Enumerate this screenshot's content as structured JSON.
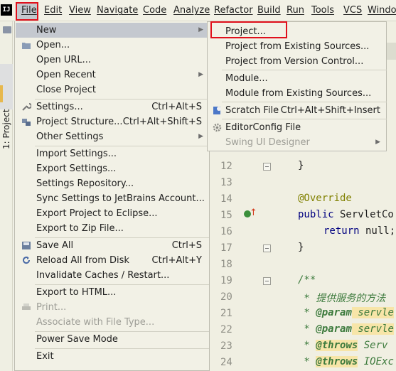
{
  "menubar": {
    "logo": "IJ",
    "items": [
      "File",
      "Edit",
      "View",
      "Navigate",
      "Code",
      "Analyze",
      "Refactor",
      "Build",
      "Run",
      "Tools",
      "VCS",
      "Window"
    ]
  },
  "sidebar": {
    "project_tab": "1: Project"
  },
  "file_menu": {
    "items": [
      {
        "label": "New",
        "arrow": "▶"
      },
      {
        "label": "Open..."
      },
      {
        "label": "Open URL..."
      },
      {
        "label": "Open Recent",
        "arrow": "▶"
      },
      {
        "label": "Close Project"
      },
      {
        "label": "Settings...",
        "shortcut": "Ctrl+Alt+S"
      },
      {
        "label": "Project Structure...",
        "shortcut": "Ctrl+Alt+Shift+S"
      },
      {
        "label": "Other Settings",
        "arrow": "▶"
      },
      {
        "label": "Import Settings..."
      },
      {
        "label": "Export Settings..."
      },
      {
        "label": "Settings Repository..."
      },
      {
        "label": "Sync Settings to JetBrains Account..."
      },
      {
        "label": "Export Project to Eclipse..."
      },
      {
        "label": "Export to Zip File..."
      },
      {
        "label": "Save All",
        "shortcut": "Ctrl+S"
      },
      {
        "label": "Reload All from Disk",
        "shortcut": "Ctrl+Alt+Y"
      },
      {
        "label": "Invalidate Caches / Restart..."
      },
      {
        "label": "Export to HTML..."
      },
      {
        "label": "Print..."
      },
      {
        "label": "Associate with File Type..."
      },
      {
        "label": "Power Save Mode"
      },
      {
        "label": "Exit"
      }
    ]
  },
  "new_submenu": {
    "items": [
      {
        "label": "Project..."
      },
      {
        "label": "Project from Existing Sources..."
      },
      {
        "label": "Project from Version Control..."
      },
      {
        "label": "Module..."
      },
      {
        "label": "Module from Existing Sources..."
      },
      {
        "label": "Scratch File",
        "shortcut": "Ctrl+Alt+Shift+Insert"
      },
      {
        "label": "EditorConfig File"
      },
      {
        "label": "Swing UI Designer",
        "arrow": "▶"
      }
    ]
  },
  "editor": {
    "line_numbers": [
      "12",
      "13",
      "14",
      "15",
      "16",
      "17",
      "18",
      "19",
      "20",
      "21",
      "22",
      "23",
      "24"
    ],
    "code": {
      "l12": "}",
      "l14": "@Override",
      "l15_kw": "public",
      "l15_rest": " ServletCo",
      "l16_kw": "return",
      "l16_rest": " null;",
      "l17": "}",
      "l19": "/**",
      "l20": " * 提供服务的方法",
      "l21_star": " * ",
      "l21_tag": "@param",
      "l21_rest": " servle",
      "l22_star": " * ",
      "l22_tag": "@param",
      "l22_rest": " servle",
      "l23_star": " * ",
      "l23_tag": "@throws",
      "l23_rest": " Serv",
      "l24_star": " * ",
      "l24_tag": "@throws",
      "l24_rest": " IOExc"
    }
  }
}
